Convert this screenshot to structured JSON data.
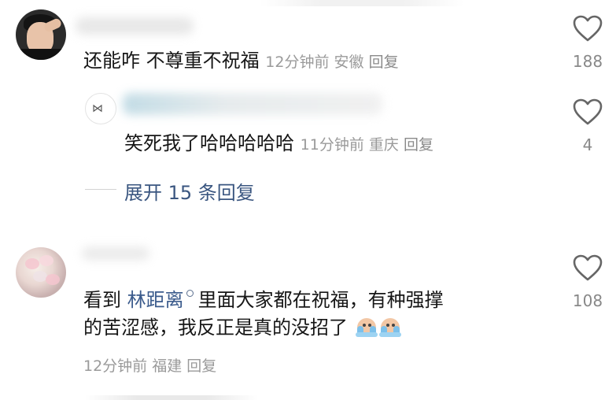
{
  "comments": [
    {
      "text": "还能咋 不尊重不祝福",
      "time": "12分钟前",
      "location": "安徽",
      "reply_label": "回复",
      "like_count": "188"
    },
    {
      "text": "笑死我了哈哈哈哈哈",
      "time": "11分钟前",
      "location": "重庆",
      "reply_label": "回复",
      "like_count": "4"
    },
    {
      "text_before": "看到",
      "mention": "林距离",
      "text_after_line1": "里面大家都在祝福，有种强撑",
      "text_line2": "的苦涩感，我反正是真的没招了",
      "time": "12分钟前",
      "location": "福建",
      "reply_label": "回复",
      "like_count": "108"
    }
  ],
  "expand_replies": "展开 15 条回复",
  "icons": {
    "like": "heart-outline-icon",
    "search": "search-icon",
    "emoji": "crying-emoji-icon",
    "bow": "bow-icon"
  },
  "colors": {
    "text": "#161616",
    "meta": "#9a9a9a",
    "link": "#3a5680",
    "heart_stroke": "#666666"
  }
}
